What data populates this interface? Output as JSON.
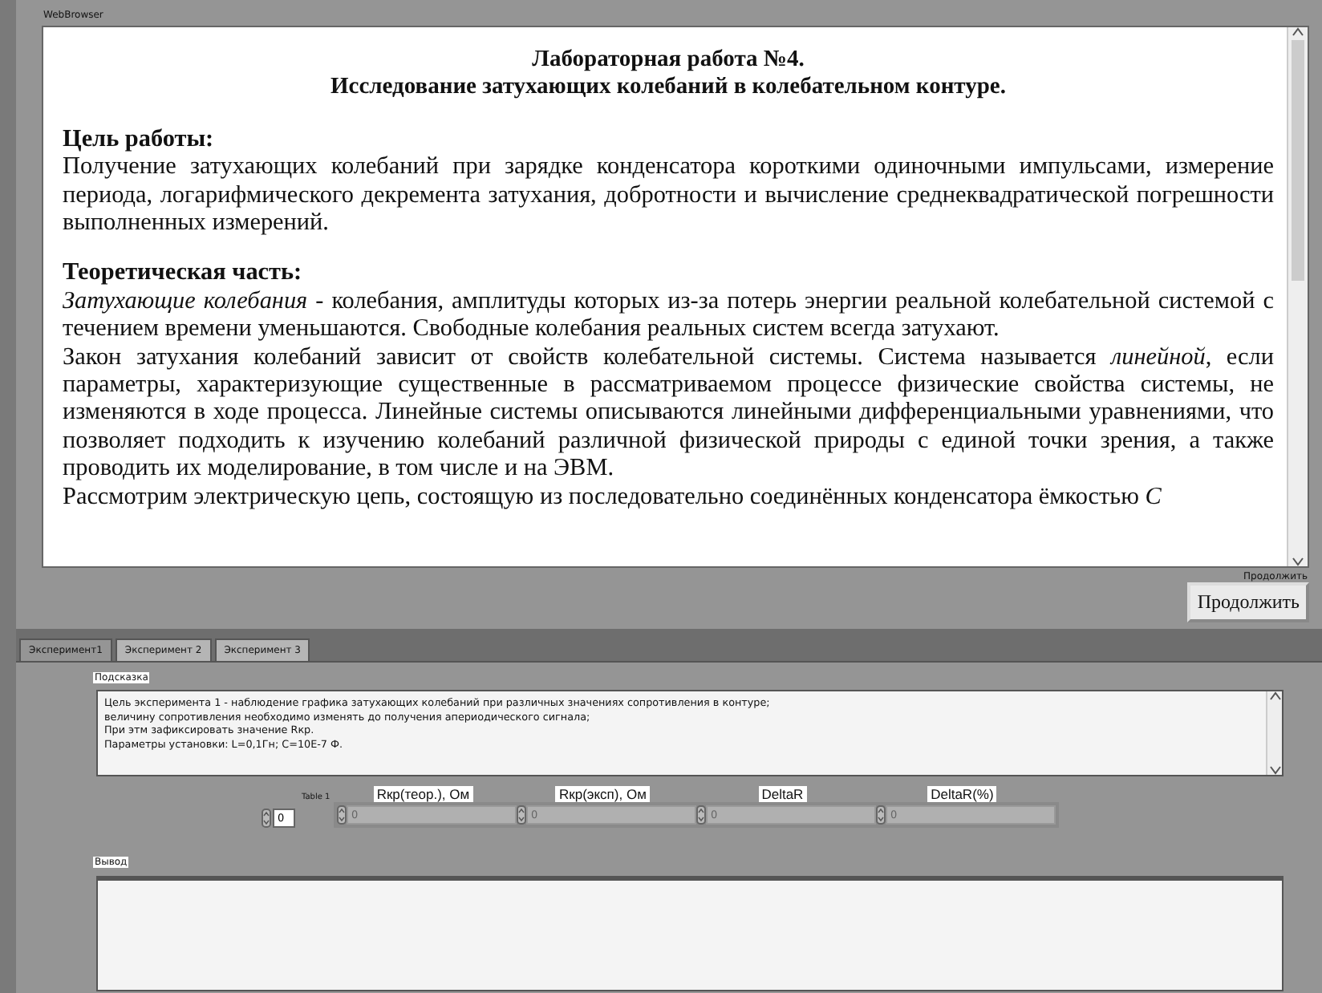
{
  "browser": {
    "label": "WebBrowser",
    "title_lines": [
      "Лабораторная работа №4.",
      "Исследование затухающих колебаний в колебательном контуре."
    ],
    "sections": [
      {
        "heading": "Цель работы:",
        "paragraphs": [
          "Получение затухающих колебаний при зарядке конденсатора короткими одиночными импульсами, измерение периода, логарифмического декремента затухания, добротности и вычисление среднеквадратической погрешности выполненных измерений."
        ]
      },
      {
        "heading": "Теоретическая часть:",
        "paragraphs": [
          "*Затухающие колебания* - колебания, амплитуды которых из-за потерь энергии реальной колебательной системой с течением времени уменьшаются. Свободные колебания реальных систем всегда затухают.",
          "Закон затухания колебаний зависит от свойств колебательной системы. Система называется *линейной*, если параметры, характеризующие существенные в рассматриваемом процессе физические свойства системы, не изменяются в ходе процесса. Линейные системы описываются линейными дифференциальными уравнениями, что позволяет подходить к изучению колебаний различной физической природы с единой точки зрения, а также проводить их моделирование, в том числе и на ЭВМ.",
          "Рассмотрим электрическую цепь, состоящую из последовательно соединённых конденсатора ёмкостью *C*"
        ]
      }
    ]
  },
  "continue": {
    "label": "Продолжить",
    "button": "Продолжить"
  },
  "tabs": [
    {
      "label": "Эксперимент1",
      "selected": true
    },
    {
      "label": "Эксперимент 2",
      "selected": false
    },
    {
      "label": "Эксперимент 3",
      "selected": false
    }
  ],
  "hint": {
    "label": "Подсказка",
    "lines": [
      "Цель эксперимента 1 -  наблюдение графика затухающих колебаний при различных значениях сопротивления в контуре;",
      "величину сопротивления необходимо изменять до получения апериодического сигнала;",
      "При этм зафиксировать значение Rкр.",
      "Параметры установки: L=0,1Гн; С=10Е-7 Ф."
    ]
  },
  "table": {
    "label": "Table 1",
    "index": "0",
    "columns": [
      {
        "header": "Rкр(теор.), Ом",
        "value": "0"
      },
      {
        "header": "Rкр(эксп), Ом",
        "value": "0"
      },
      {
        "header": "DeltaR",
        "value": "0"
      },
      {
        "header": "DeltaR(%)",
        "value": "0"
      }
    ]
  },
  "output": {
    "label": "Вывод"
  }
}
